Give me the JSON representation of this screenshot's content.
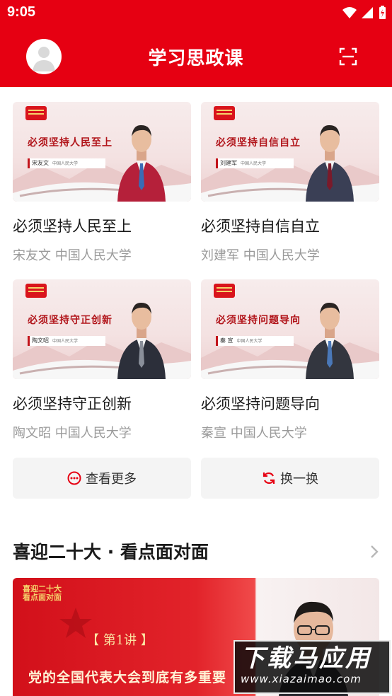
{
  "status_bar": {
    "time": "9:05"
  },
  "header": {
    "title": "学习思政课"
  },
  "courses": [
    {
      "title": "必须坚持人民至上",
      "author": "宋友文 中国人民大学",
      "slogan": "必须坚持人民至上",
      "plate": "宋友文",
      "org": "中国人民大学",
      "tie": "#3a6bb5",
      "shirt": "#b5203a"
    },
    {
      "title": "必须坚持自信自立",
      "author": "刘建军 中国人民大学",
      "slogan": "必须坚持自信自立",
      "plate": "刘建军",
      "org": "中国人民大学",
      "tie": "#7a1a2a",
      "shirt": "#3a3f55"
    },
    {
      "title": "必须坚持守正创新",
      "author": "陶文昭 中国人民大学",
      "slogan": "必须坚持守正创新",
      "plate": "陶文昭",
      "org": "中国人民大学",
      "tie": "#8a8f9a",
      "shirt": "#2c2f3a"
    },
    {
      "title": "必须坚持问题导向",
      "author": "秦宣 中国人民大学",
      "slogan": "必须坚持问题导向",
      "plate": "秦 宣",
      "org": "中国人民大学",
      "tie": "#4a78b8",
      "shirt": "#33363f"
    }
  ],
  "actions": {
    "more_label": "查看更多",
    "refresh_label": "换一换"
  },
  "section": {
    "title": "喜迎二十大 · 看点面对面",
    "banner": {
      "logo_line1": "喜迎二十大",
      "logo_line2": "看点面对面",
      "lecture": "【  第1讲  】",
      "headline": "党的全国代表大会到底有多重要"
    }
  },
  "watermark": {
    "main": "下载马应用",
    "url": "www.xiazaimao.com"
  },
  "colors": {
    "brand_red": "#e60012",
    "muted_text": "#9a9a9a"
  }
}
